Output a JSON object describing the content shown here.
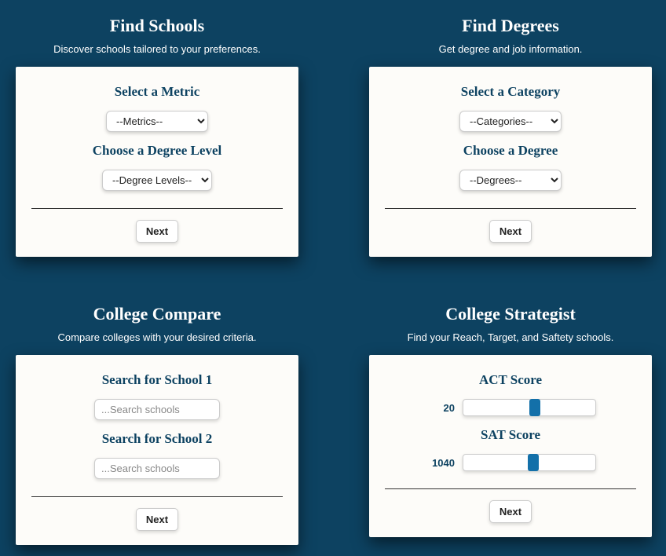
{
  "tools": {
    "findSchools": {
      "title": "Find Schools",
      "subtitle": "Discover schools tailored to your preferences.",
      "metricLabel": "Select a Metric",
      "metricPlaceholder": "--Metrics--",
      "degreeLevelLabel": "Choose a Degree Level",
      "degreeLevelPlaceholder": "--Degree Levels--",
      "nextLabel": "Next"
    },
    "findDegrees": {
      "title": "Find Degrees",
      "subtitle": "Get degree and job information.",
      "categoryLabel": "Select a Category",
      "categoryPlaceholder": "--Categories--",
      "degreeLabel": "Choose a Degree",
      "degreePlaceholder": "--Degrees--",
      "nextLabel": "Next"
    },
    "collegeCompare": {
      "title": "College Compare",
      "subtitle": "Compare colleges with your desired criteria.",
      "school1Label": "Search for School 1",
      "school2Label": "Search for School 2",
      "searchPlaceholder": "...Search schools",
      "nextLabel": "Next"
    },
    "collegeStrategist": {
      "title": "College Strategist",
      "subtitle": "Find your Reach, Target, and Saftety schools.",
      "actLabel": "ACT Score",
      "actValue": "20",
      "satLabel": "SAT Score",
      "satValue": "1040",
      "nextLabel": "Next"
    }
  }
}
